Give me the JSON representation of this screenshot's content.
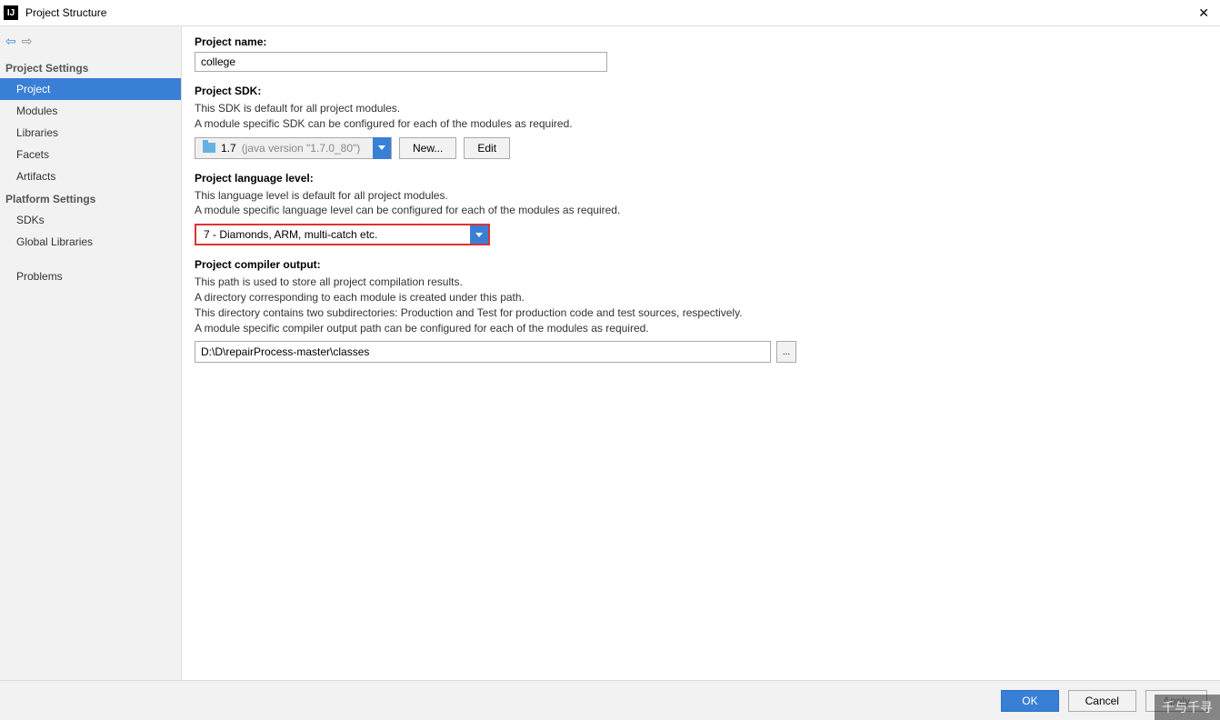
{
  "window": {
    "title": "Project Structure",
    "close": "✕"
  },
  "sidebar": {
    "projectSettingsHeader": "Project Settings",
    "platformSettingsHeader": "Platform Settings",
    "items": {
      "project": "Project",
      "modules": "Modules",
      "libraries": "Libraries",
      "facets": "Facets",
      "artifacts": "Artifacts",
      "sdks": "SDKs",
      "globalLibraries": "Global Libraries",
      "problems": "Problems"
    }
  },
  "project": {
    "nameLabel": "Project name:",
    "nameValue": "college",
    "sdkLabel": "Project SDK:",
    "sdkHelp1": "This SDK is default for all project modules.",
    "sdkHelp2": "A module specific SDK can be configured for each of the modules as required.",
    "sdkValue": "1.7",
    "sdkVersion": "(java version \"1.7.0_80\")",
    "newBtn": "New...",
    "editBtn": "Edit",
    "langLabel": "Project language level:",
    "langHelp1": "This language level is default for all project modules.",
    "langHelp2": "A module specific language level can be configured for each of the modules as required.",
    "langValue": "7 - Diamonds, ARM, multi-catch etc.",
    "outputLabel": "Project compiler output:",
    "outputHelp1": "This path is used to store all project compilation results.",
    "outputHelp2": "A directory corresponding to each module is created under this path.",
    "outputHelp3": "This directory contains two subdirectories: Production and Test for production code and test sources, respectively.",
    "outputHelp4": "A module specific compiler output path can be configured for each of the modules as required.",
    "outputValue": "D:\\D\\repairProcess-master\\classes",
    "browseBtn": "..."
  },
  "footer": {
    "ok": "OK",
    "cancel": "Cancel",
    "apply": "Apply"
  },
  "watermark": "千与千寻"
}
